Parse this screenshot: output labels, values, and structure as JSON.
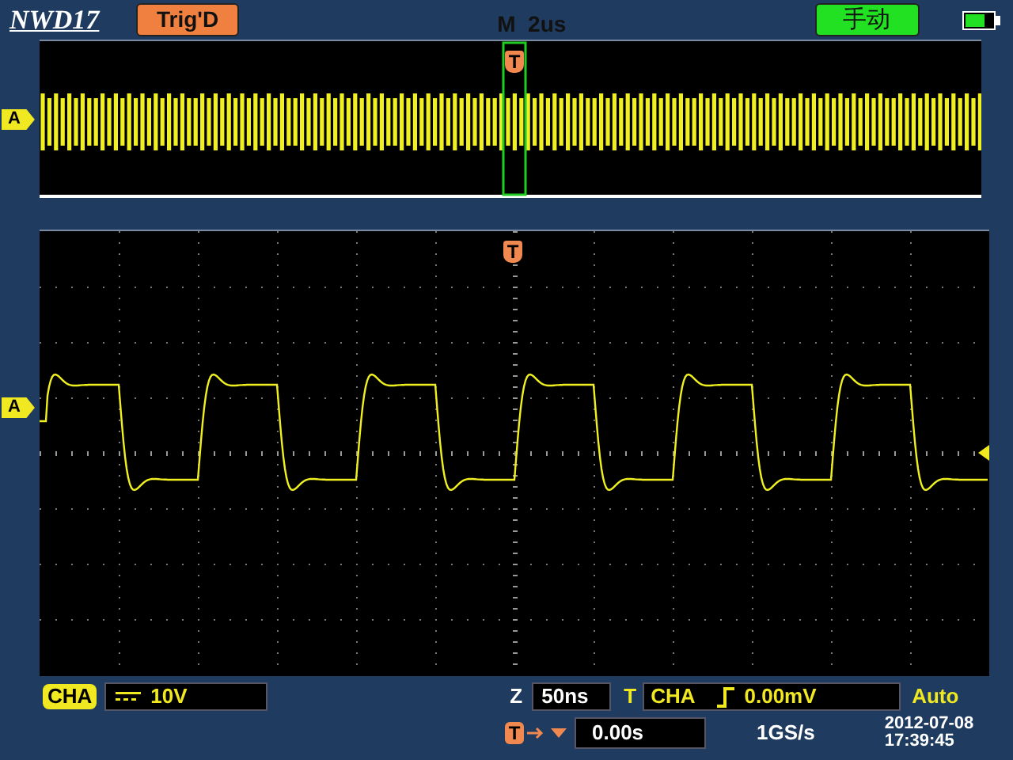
{
  "header": {
    "brand": "NWD17",
    "trigger_status": "Trig'D",
    "timebase": "M  2us",
    "mode": "手动"
  },
  "overview": {
    "channel_marker": "A",
    "trigger_marker": "T"
  },
  "display": {
    "channel_marker": "A",
    "trigger_marker": "T"
  },
  "channel": {
    "name": "CHA",
    "scale": "10V"
  },
  "horizontal": {
    "label": "Z",
    "value": "50ns"
  },
  "trigger": {
    "label": "T",
    "source": "CHA",
    "trigger_level": "0.00mV",
    "mode": "Auto"
  },
  "position": {
    "marker": "T",
    "value": "0.00s"
  },
  "sample_rate": "1GS/s",
  "date": "2012-07-08",
  "time": "17:39:45"
}
